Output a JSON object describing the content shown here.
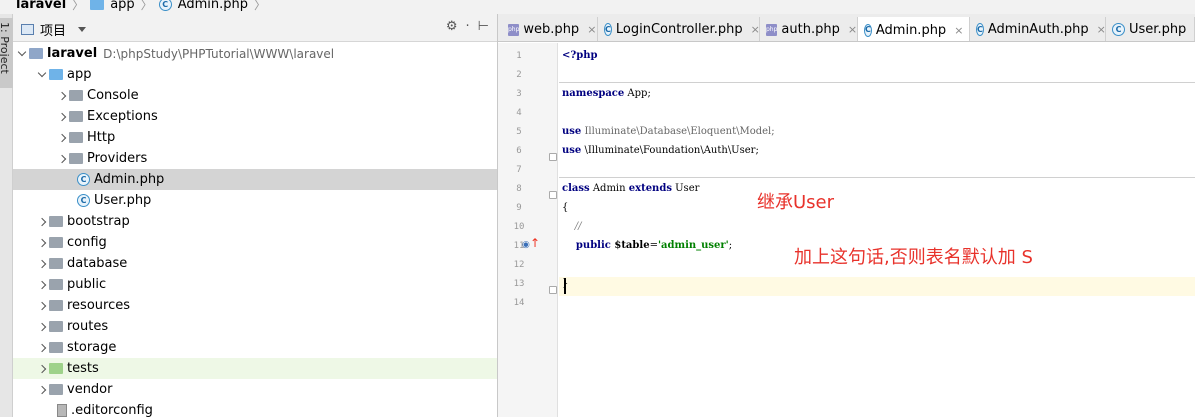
{
  "breadcrumb": {
    "items": [
      "laravel",
      "app",
      "Admin.php"
    ]
  },
  "tool_strip": {
    "project_label": "1: Project"
  },
  "project_panel": {
    "title": "项目",
    "tools": [
      "⚙",
      "·",
      "⊢"
    ],
    "root": {
      "name": "laravel",
      "path": "D:\\phpStudy\\PHPTutorial\\WWW\\laravel"
    },
    "rows": [
      {
        "label": "app",
        "kind": "folder-open",
        "icon": "folder-blue"
      },
      {
        "label": "Console",
        "kind": "folder",
        "icon": "folder-gray"
      },
      {
        "label": "Exceptions",
        "kind": "folder",
        "icon": "folder-gray"
      },
      {
        "label": "Http",
        "kind": "folder",
        "icon": "folder-gray"
      },
      {
        "label": "Providers",
        "kind": "folder",
        "icon": "folder-gray"
      },
      {
        "label": "Admin.php",
        "kind": "file",
        "icon": "php-class"
      },
      {
        "label": "User.php",
        "kind": "file",
        "icon": "php-class"
      },
      {
        "label": "bootstrap",
        "kind": "folder",
        "icon": "folder-gray"
      },
      {
        "label": "config",
        "kind": "folder",
        "icon": "folder-gray"
      },
      {
        "label": "database",
        "kind": "folder",
        "icon": "folder-gray"
      },
      {
        "label": "public",
        "kind": "folder",
        "icon": "folder-gray"
      },
      {
        "label": "resources",
        "kind": "folder",
        "icon": "folder-gray"
      },
      {
        "label": "routes",
        "kind": "folder",
        "icon": "folder-gray"
      },
      {
        "label": "storage",
        "kind": "folder",
        "icon": "folder-gray"
      },
      {
        "label": "tests",
        "kind": "folder",
        "icon": "folder-green"
      },
      {
        "label": "vendor",
        "kind": "folder",
        "icon": "folder-gray"
      },
      {
        "label": ".editorconfig",
        "kind": "file",
        "icon": "config-file"
      }
    ]
  },
  "editor": {
    "tabs": [
      {
        "label": "web.php",
        "icon": "php-file"
      },
      {
        "label": "LoginController.php",
        "icon": "php-class"
      },
      {
        "label": "auth.php",
        "icon": "php-file"
      },
      {
        "label": "Admin.php",
        "icon": "php-class",
        "active": true
      },
      {
        "label": "AdminAuth.php",
        "icon": "php-class"
      },
      {
        "label": "User.php",
        "icon": "php-class"
      }
    ],
    "close_glyph": "×",
    "php_badge": "php",
    "class_badge": "C",
    "line_numbers": [
      "1",
      "2",
      "3",
      "4",
      "5",
      "6",
      "7",
      "8",
      "9",
      "10",
      "11",
      "12",
      "13",
      "14"
    ],
    "code": {
      "l1": "<?php",
      "l3_kw": "namespace",
      "l3_rest": " App;",
      "l5_kw": "use",
      "l5_rest": " Illuminate\\Database\\Eloquent\\Model;",
      "l6_kw": "use",
      "l6_rest": " \\Illuminate\\Foundation\\Auth\\User;",
      "l8_kw1": "class",
      "l8_name": " Admin ",
      "l8_kw2": "extends",
      "l8_rest": " User",
      "l9": "{",
      "l10": "    //",
      "l11_kw": "    public",
      "l11_var": " $table",
      "l11_eq": "=",
      "l11_str": "'admin_user'",
      "l11_end": ";",
      "l13": "}"
    },
    "annotations": {
      "inherit": "继承User",
      "table_note": "加上这句话,否则表名默认加  S"
    }
  },
  "colors": {
    "annotation": "#e8322b",
    "keyword": "#000080",
    "string": "#008000",
    "current_line": "#fffae3"
  }
}
